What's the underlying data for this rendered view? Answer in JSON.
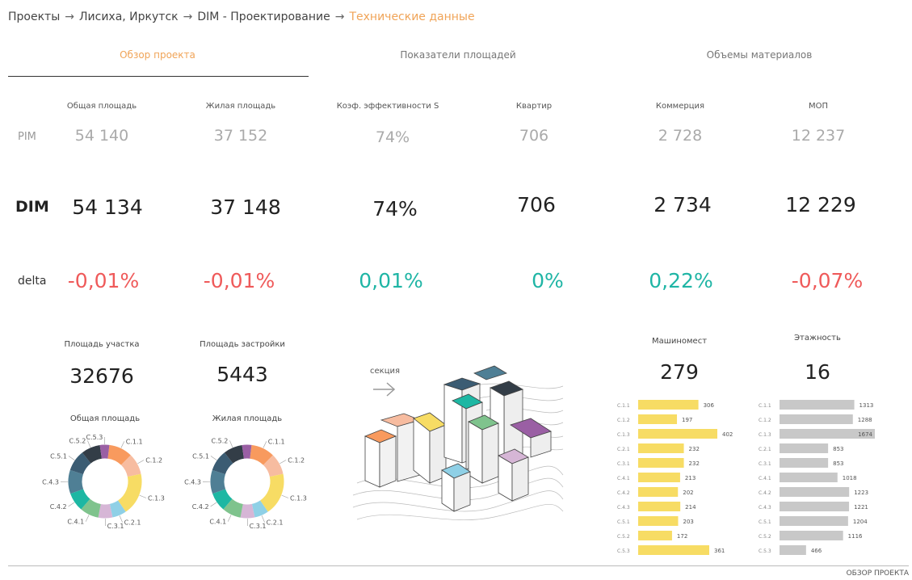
{
  "breadcrumb": {
    "items": [
      "Проекты",
      "Лисиха, Иркутск",
      "DIM - Проектирование"
    ],
    "current": "Технические данные",
    "separator": "→"
  },
  "tabs": [
    "Обзор проекта",
    "Показатели площадей",
    "Объемы материалов"
  ],
  "metrics": {
    "headers": [
      "Общая площадь",
      "Жилая площадь",
      "Коэф. эффективности S",
      "Квартир",
      "Коммерция",
      "МОП"
    ],
    "row_labels": {
      "pim": "PIM",
      "dim": "DIM",
      "delta": "delta"
    },
    "pim": [
      "54 140",
      "37 152",
      "74%",
      "706",
      "2 728",
      "12 237"
    ],
    "dim": [
      "54 134",
      "37 148",
      "74%",
      "706",
      "2 734",
      "12 229"
    ],
    "delta": [
      "-0,01%",
      "-0,01%",
      "0,01%",
      "0%",
      "0,22%",
      "-0,07%"
    ],
    "delta_sign": [
      "neg",
      "neg",
      "pos",
      "pos",
      "pos",
      "neg"
    ]
  },
  "site": {
    "plot_area_label": "Площадь участка",
    "plot_area": "32676",
    "built_area_label": "Площадь застройки",
    "built_area": "5443",
    "parking_label": "Машиномест",
    "parking": "279",
    "floors_label": "Этажность",
    "floors": "16"
  },
  "donuts": [
    {
      "title": "Общая площадь",
      "segments": [
        {
          "label": "С.1.1",
          "value": 10,
          "color": "#f89a5e"
        },
        {
          "label": "С.1.2",
          "value": 9,
          "color": "#f7bca0"
        },
        {
          "label": "С.1.3",
          "value": 18,
          "color": "#f7dc64"
        },
        {
          "label": "С.2.1",
          "value": 6,
          "color": "#8fd0e6"
        },
        {
          "label": "С.3.1",
          "value": 6,
          "color": "#d6b6d6"
        },
        {
          "label": "С.4.1",
          "value": 8,
          "color": "#7fc38d"
        },
        {
          "label": "С.4.2",
          "value": 8,
          "color": "#1db7a3"
        },
        {
          "label": "С.4.3",
          "value": 10,
          "color": "#4f7f95"
        },
        {
          "label": "С.5.1",
          "value": 9,
          "color": "#3b5c73"
        },
        {
          "label": "С.5.2",
          "value": 8,
          "color": "#333d47"
        },
        {
          "label": "С.5.3",
          "value": 4,
          "color": "#9a5fa4"
        }
      ]
    },
    {
      "title": "Жилая площадь",
      "segments": [
        {
          "label": "С.1.1",
          "value": 10,
          "color": "#f89a5e"
        },
        {
          "label": "С.1.2",
          "value": 9,
          "color": "#f7bca0"
        },
        {
          "label": "С.1.3",
          "value": 18,
          "color": "#f7dc64"
        },
        {
          "label": "С.2.1",
          "value": 6,
          "color": "#8fd0e6"
        },
        {
          "label": "С.3.1",
          "value": 6,
          "color": "#d6b6d6"
        },
        {
          "label": "С.4.1",
          "value": 8,
          "color": "#7fc38d"
        },
        {
          "label": "С.4.2",
          "value": 8,
          "color": "#1db7a3"
        },
        {
          "label": "С.4.3",
          "value": 10,
          "color": "#4f7f95"
        },
        {
          "label": "С.5.1",
          "value": 9,
          "color": "#3b5c73"
        },
        {
          "label": "С.5.2",
          "value": 8,
          "color": "#333d47"
        },
        {
          "label": "С.5.3",
          "value": 4,
          "color": "#9a5fa4"
        }
      ]
    }
  ],
  "donut_visible_labels": [
    [
      "С.1.1",
      "С.1.2",
      "С.1.3",
      "С.2.1",
      "С.3.1",
      "С.4.1",
      "С.4.2",
      "С.4.3",
      "С.5.1",
      "С.5.2",
      "С.5.3"
    ],
    [
      "С.1.1",
      "С.1.2",
      "С.1.3",
      "С.2.1",
      "С.3.1",
      "С.4.1",
      "С.4.2",
      "С.4.3",
      "С.5.1",
      "С.5.2"
    ]
  ],
  "section_label": "секция",
  "chart_data": [
    {
      "type": "bar",
      "title": "Машиномест",
      "categories": [
        "С.1.1",
        "С.1.2",
        "С.1.3",
        "С.2.1",
        "С.3.1",
        "С.4.1",
        "С.4.2",
        "С.4.3",
        "С.5.1",
        "С.5.2",
        "С.5.3"
      ],
      "values": [
        306,
        197,
        402,
        232,
        232,
        213,
        202,
        214,
        203,
        172,
        361
      ],
      "color": "#f7dc64"
    },
    {
      "type": "bar",
      "title": "Этажность",
      "categories": [
        "С.1.1",
        "С.1.2",
        "С.1.3",
        "С.2.1",
        "С.3.1",
        "С.4.1",
        "С.4.2",
        "С.4.3",
        "С.5.1",
        "С.5.2",
        "С.5.3"
      ],
      "values": [
        1313,
        1288,
        1674,
        853,
        853,
        1018,
        1223,
        1221,
        1204,
        1116,
        466
      ],
      "color": "#c8c8c8"
    }
  ],
  "footer": "ОБЗОР ПРОЕКТА",
  "colors": {
    "accent": "#f0a458",
    "negative": "#ef5a5a",
    "positive": "#1fb5a5"
  }
}
